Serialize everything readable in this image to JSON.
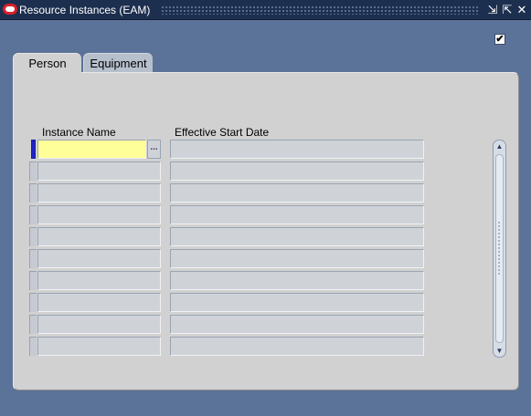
{
  "window": {
    "title": "Resource Instances (EAM)",
    "controls": [
      "minimize-icon",
      "maximize-icon",
      "close-icon"
    ]
  },
  "checkbox": {
    "checked": true,
    "mark": "✔"
  },
  "tabs": [
    {
      "label": "Person",
      "active": true
    },
    {
      "label": "Equipment",
      "active": false
    }
  ],
  "columns": {
    "instance_name": "Instance Name",
    "effective_start_date": "Effective Start Date"
  },
  "rows": [
    {
      "instance_name": "",
      "effective_start_date": "",
      "current": true
    },
    {
      "instance_name": "",
      "effective_start_date": ""
    },
    {
      "instance_name": "",
      "effective_start_date": ""
    },
    {
      "instance_name": "",
      "effective_start_date": ""
    },
    {
      "instance_name": "",
      "effective_start_date": ""
    },
    {
      "instance_name": "",
      "effective_start_date": ""
    },
    {
      "instance_name": "",
      "effective_start_date": ""
    },
    {
      "instance_name": "",
      "effective_start_date": ""
    },
    {
      "instance_name": "",
      "effective_start_date": ""
    },
    {
      "instance_name": "",
      "effective_start_date": ""
    }
  ],
  "lov_button": "...",
  "colors": {
    "window_bg": "#5b7299",
    "title_bar": "#1d2f4f",
    "panel_bg": "#d1d1d1",
    "active_field": "#ffff99",
    "current_record": "#2024c8"
  }
}
